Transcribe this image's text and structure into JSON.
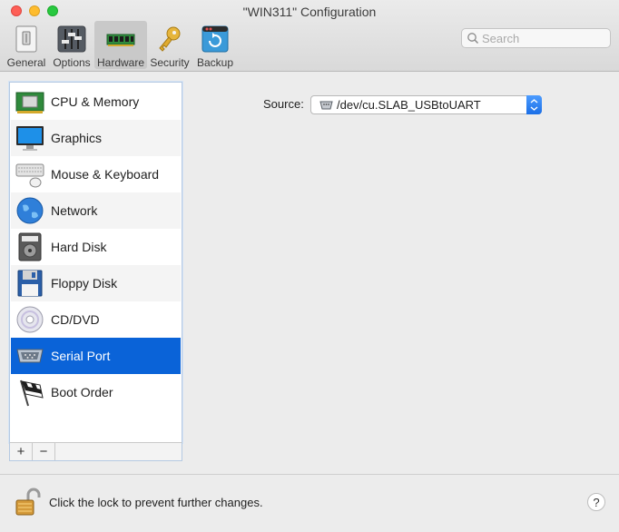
{
  "window": {
    "title": "\"WIN311\" Configuration"
  },
  "toolbar": {
    "tabs": [
      {
        "label": "General",
        "icon": "general-icon"
      },
      {
        "label": "Options",
        "icon": "options-sliders-icon"
      },
      {
        "label": "Hardware",
        "icon": "memory-chip-icon",
        "active": true
      },
      {
        "label": "Security",
        "icon": "key-icon"
      },
      {
        "label": "Backup",
        "icon": "backup-icon"
      }
    ]
  },
  "search": {
    "placeholder": "Search",
    "value": ""
  },
  "devices": [
    {
      "label": "CPU & Memory",
      "icon": "cpu-memory-icon"
    },
    {
      "label": "Graphics",
      "icon": "monitor-icon"
    },
    {
      "label": "Mouse & Keyboard",
      "icon": "mouse-keyboard-icon"
    },
    {
      "label": "Network",
      "icon": "globe-icon"
    },
    {
      "label": "Hard Disk",
      "icon": "hard-disk-icon"
    },
    {
      "label": "Floppy Disk",
      "icon": "floppy-disk-icon"
    },
    {
      "label": "CD/DVD",
      "icon": "cd-dvd-icon"
    },
    {
      "label": "Serial Port",
      "icon": "serial-port-icon",
      "selected": true
    },
    {
      "label": "Boot Order",
      "icon": "checkered-flag-icon"
    }
  ],
  "list_controls": {
    "add_label": "+",
    "remove_label": "−"
  },
  "source": {
    "label": "Source:",
    "value": "/dev/cu.SLAB_USBtoUART"
  },
  "footer": {
    "lock_text": "Click the lock to prevent further changes.",
    "help_label": "?"
  },
  "colors": {
    "selection": "#0a63d8",
    "accent": "#1b6fe6"
  }
}
